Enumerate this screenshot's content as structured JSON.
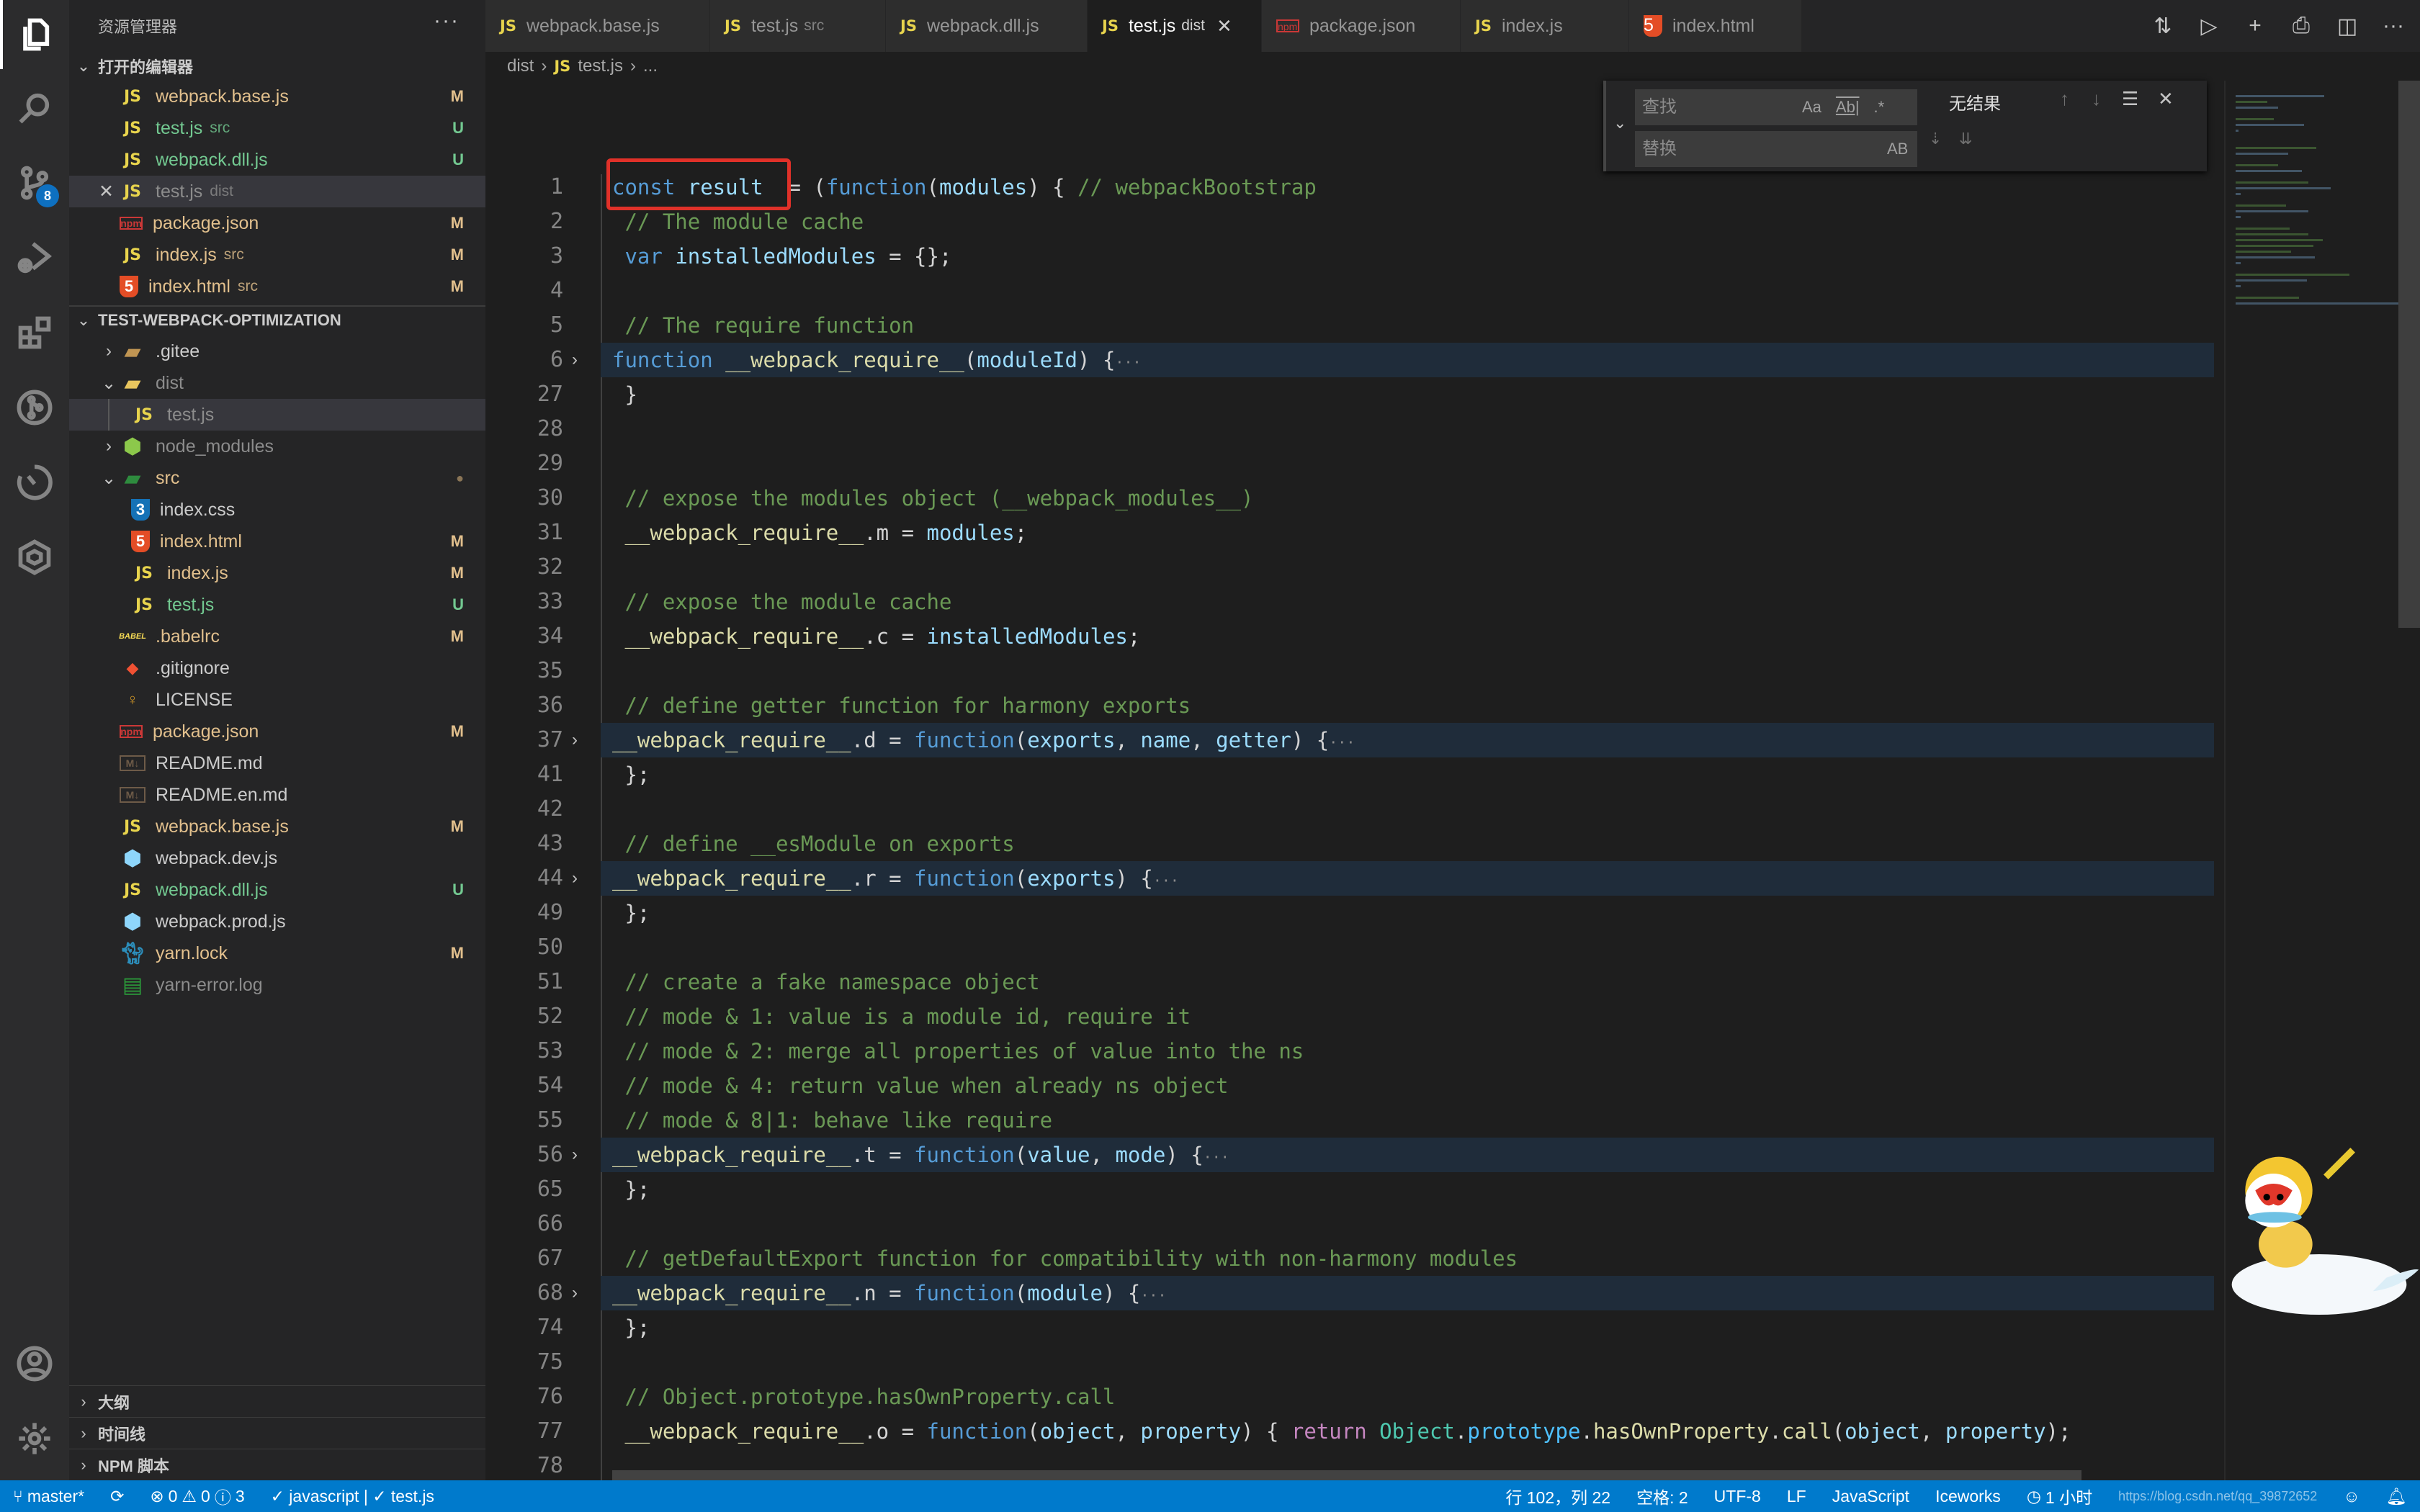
{
  "activity_bar": {
    "items": [
      {
        "name": "explorer",
        "icon": "files-icon",
        "active": true
      },
      {
        "name": "search",
        "icon": "search-icon"
      },
      {
        "name": "source-control",
        "icon": "source-control-icon",
        "badge": "8"
      },
      {
        "name": "run-debug",
        "icon": "debug-icon"
      },
      {
        "name": "extensions",
        "icon": "extensions-icon"
      },
      {
        "name": "git-graph",
        "icon": "git-graph-icon"
      },
      {
        "name": "timer",
        "icon": "timer-icon"
      },
      {
        "name": "iceworks",
        "icon": "iceworks-icon"
      }
    ],
    "bottom": [
      {
        "name": "accounts",
        "icon": "account-icon"
      },
      {
        "name": "manage",
        "icon": "gear-icon"
      }
    ]
  },
  "sidebar": {
    "title": "资源管理器",
    "more": "···",
    "open_editors": {
      "header": "打开的编辑器",
      "items": [
        {
          "icon": "JS",
          "name": "webpack.base.js",
          "sub": "",
          "status": "M",
          "kind": "mod"
        },
        {
          "icon": "JS",
          "name": "test.js",
          "sub": "src",
          "status": "U",
          "kind": "unt"
        },
        {
          "icon": "JS",
          "name": "webpack.dll.js",
          "sub": "",
          "status": "U",
          "kind": "unt"
        },
        {
          "icon": "JS",
          "name": "test.js",
          "sub": "dist",
          "status": "",
          "kind": "dim",
          "selected": true,
          "close": "✕"
        },
        {
          "icon": "npm",
          "name": "package.json",
          "sub": "",
          "status": "M",
          "kind": "mod"
        },
        {
          "icon": "JS",
          "name": "index.js",
          "sub": "src",
          "status": "M",
          "kind": "mod"
        },
        {
          "icon": "html",
          "name": "index.html",
          "sub": "src",
          "status": "M",
          "kind": "mod"
        }
      ]
    },
    "project": {
      "header": "TEST-WEBPACK-OPTIMIZATION",
      "items": [
        {
          "depth": 1,
          "twisty": "›",
          "icon": "folder",
          "name": ".gitee",
          "status": "",
          "kind": ""
        },
        {
          "depth": 1,
          "twisty": "⌄",
          "icon": "folder-open",
          "name": "dist",
          "status": "",
          "kind": "dim"
        },
        {
          "depth": 2,
          "twisty": "",
          "icon": "JS",
          "name": "test.js",
          "status": "",
          "kind": "dim",
          "selected": true
        },
        {
          "depth": 1,
          "twisty": "›",
          "icon": "node",
          "name": "node_modules",
          "status": "",
          "kind": "dim"
        },
        {
          "depth": 1,
          "twisty": "⌄",
          "icon": "src-folder",
          "name": "src",
          "status": "●",
          "kind": "mod"
        },
        {
          "depth": 2,
          "twisty": "",
          "icon": "css",
          "name": "index.css",
          "status": "",
          "kind": ""
        },
        {
          "depth": 2,
          "twisty": "",
          "icon": "html",
          "name": "index.html",
          "status": "M",
          "kind": "mod"
        },
        {
          "depth": 2,
          "twisty": "",
          "icon": "JS",
          "name": "index.js",
          "status": "M",
          "kind": "mod"
        },
        {
          "depth": 2,
          "twisty": "",
          "icon": "JS",
          "name": "test.js",
          "status": "U",
          "kind": "unt"
        },
        {
          "depth": 1,
          "twisty": "",
          "icon": "babel",
          "name": ".babelrc",
          "status": "M",
          "kind": "mod"
        },
        {
          "depth": 1,
          "twisty": "",
          "icon": "git",
          "name": ".gitignore",
          "status": "",
          "kind": ""
        },
        {
          "depth": 1,
          "twisty": "",
          "icon": "license",
          "name": "LICENSE",
          "status": "",
          "kind": ""
        },
        {
          "depth": 1,
          "twisty": "",
          "icon": "npm",
          "name": "package.json",
          "status": "M",
          "kind": "mod"
        },
        {
          "depth": 1,
          "twisty": "",
          "icon": "md",
          "name": "README.md",
          "status": "",
          "kind": ""
        },
        {
          "depth": 1,
          "twisty": "",
          "icon": "md",
          "name": "README.en.md",
          "status": "",
          "kind": ""
        },
        {
          "depth": 1,
          "twisty": "",
          "icon": "JS",
          "name": "webpack.base.js",
          "status": "M",
          "kind": "mod"
        },
        {
          "depth": 1,
          "twisty": "",
          "icon": "webpack",
          "name": "webpack.dev.js",
          "status": "",
          "kind": ""
        },
        {
          "depth": 1,
          "twisty": "",
          "icon": "JS",
          "name": "webpack.dll.js",
          "status": "U",
          "kind": "unt"
        },
        {
          "depth": 1,
          "twisty": "",
          "icon": "webpack",
          "name": "webpack.prod.js",
          "status": "",
          "kind": ""
        },
        {
          "depth": 1,
          "twisty": "",
          "icon": "yarn",
          "name": "yarn.lock",
          "status": "M",
          "kind": "mod"
        },
        {
          "depth": 1,
          "twisty": "",
          "icon": "log",
          "name": "yarn-error.log",
          "status": "",
          "kind": "dim"
        }
      ]
    },
    "bottom_sections": [
      "大纲",
      "时间线",
      "NPM 脚本"
    ]
  },
  "tabs": [
    {
      "icon": "JS",
      "name": "webpack.base.js",
      "sub": ""
    },
    {
      "icon": "JS",
      "name": "test.js",
      "sub": "src"
    },
    {
      "icon": "JS",
      "name": "webpack.dll.js",
      "sub": ""
    },
    {
      "icon": "JS",
      "name": "test.js",
      "sub": "dist",
      "active": true,
      "close": "✕"
    },
    {
      "icon": "npm",
      "name": "package.json",
      "sub": ""
    },
    {
      "icon": "JS",
      "name": "index.js",
      "sub": ""
    },
    {
      "icon": "html",
      "name": "index.html",
      "sub": ""
    }
  ],
  "tab_actions": [
    {
      "name": "open-changes",
      "glyph": "⇅"
    },
    {
      "name": "run",
      "glyph": "▷"
    },
    {
      "name": "new",
      "glyph": "+"
    },
    {
      "name": "preview",
      "glyph": "⎙"
    },
    {
      "name": "split-editor",
      "glyph": "◫"
    },
    {
      "name": "more-actions",
      "glyph": "···"
    }
  ],
  "breadcrumb": {
    "parts": [
      "dist",
      "test.js",
      "..."
    ],
    "sep": "›"
  },
  "find_widget": {
    "find_placeholder": "查找",
    "replace_placeholder": "替换",
    "match_case": "Aa",
    "whole_word": "Ab|",
    "regex": ".*",
    "preserve_case": "AB",
    "result": "无结果",
    "prev": "↑",
    "next": "↓",
    "in_selection": "☰",
    "close": "✕",
    "replace_one": "⇣",
    "replace_all": "⇊",
    "toggle": "⌄"
  },
  "editor": {
    "lines": [
      {
        "n": "1",
        "tokens": [
          [
            "kw",
            "const "
          ],
          [
            "var",
            "result"
          ],
          [
            "",
            "  = ("
          ],
          [
            "kw",
            "function"
          ],
          [
            "",
            "("
          ],
          [
            "var",
            "modules"
          ],
          [
            "",
            ") { "
          ],
          [
            "com",
            "// webpackBootstrap"
          ]
        ]
      },
      {
        "n": "2",
        "tokens": [
          [
            "com",
            " // The module cache"
          ]
        ]
      },
      {
        "n": "3",
        "tokens": [
          [
            "kw",
            " var "
          ],
          [
            "var",
            "installedModules"
          ],
          [
            "",
            " = {};"
          ]
        ]
      },
      {
        "n": "4",
        "tokens": []
      },
      {
        "n": "5",
        "tokens": [
          [
            "com",
            " // The require function"
          ]
        ]
      },
      {
        "n": "6",
        "fold": true,
        "tokens": [
          [
            "kw",
            "function "
          ],
          [
            "fn",
            "__webpack_require__"
          ],
          [
            "",
            "("
          ],
          [
            "var",
            "moduleId"
          ],
          [
            "",
            ") {"
          ],
          [
            "ell",
            "···"
          ]
        ]
      },
      {
        "n": "27",
        "tokens": [
          [
            "",
            " }"
          ]
        ]
      },
      {
        "n": "28",
        "tokens": []
      },
      {
        "n": "29",
        "tokens": []
      },
      {
        "n": "30",
        "tokens": [
          [
            "com",
            " // expose the modules object (__webpack_modules__)"
          ]
        ]
      },
      {
        "n": "31",
        "tokens": [
          [
            "fn",
            " __webpack_require__"
          ],
          [
            "",
            ".m = "
          ],
          [
            "var",
            "modules"
          ],
          [
            "",
            ";"
          ]
        ]
      },
      {
        "n": "32",
        "tokens": []
      },
      {
        "n": "33",
        "tokens": [
          [
            "com",
            " // expose the module cache"
          ]
        ]
      },
      {
        "n": "34",
        "tokens": [
          [
            "fn",
            " __webpack_require__"
          ],
          [
            "",
            ".c = "
          ],
          [
            "var",
            "installedModules"
          ],
          [
            "",
            ";"
          ]
        ]
      },
      {
        "n": "35",
        "tokens": []
      },
      {
        "n": "36",
        "tokens": [
          [
            "com",
            " // define getter function for harmony exports"
          ]
        ]
      },
      {
        "n": "37",
        "fold": true,
        "tokens": [
          [
            "fn",
            "__webpack_require__"
          ],
          [
            "",
            ".d = "
          ],
          [
            "kw",
            "function"
          ],
          [
            "",
            "("
          ],
          [
            "var",
            "exports"
          ],
          [
            "",
            ", "
          ],
          [
            "var",
            "name"
          ],
          [
            "",
            ", "
          ],
          [
            "var",
            "getter"
          ],
          [
            "",
            ") {"
          ],
          [
            "ell",
            "···"
          ]
        ]
      },
      {
        "n": "41",
        "tokens": [
          [
            "",
            " };"
          ]
        ]
      },
      {
        "n": "42",
        "tokens": []
      },
      {
        "n": "43",
        "tokens": [
          [
            "com",
            " // define __esModule on exports"
          ]
        ]
      },
      {
        "n": "44",
        "fold": true,
        "tokens": [
          [
            "fn",
            "__webpack_require__"
          ],
          [
            "",
            ".r = "
          ],
          [
            "kw",
            "function"
          ],
          [
            "",
            "("
          ],
          [
            "var",
            "exports"
          ],
          [
            "",
            ") {"
          ],
          [
            "ell",
            "···"
          ]
        ]
      },
      {
        "n": "49",
        "tokens": [
          [
            "",
            " };"
          ]
        ]
      },
      {
        "n": "50",
        "tokens": []
      },
      {
        "n": "51",
        "tokens": [
          [
            "com",
            " // create a fake namespace object"
          ]
        ]
      },
      {
        "n": "52",
        "tokens": [
          [
            "com",
            " // mode & 1: value is a module id, require it"
          ]
        ]
      },
      {
        "n": "53",
        "tokens": [
          [
            "com",
            " // mode & 2: merge all properties of value into the ns"
          ]
        ]
      },
      {
        "n": "54",
        "tokens": [
          [
            "com",
            " // mode & 4: return value when already ns object"
          ]
        ]
      },
      {
        "n": "55",
        "tokens": [
          [
            "com",
            " // mode & 8|1: behave like require"
          ]
        ]
      },
      {
        "n": "56",
        "fold": true,
        "tokens": [
          [
            "fn",
            "__webpack_require__"
          ],
          [
            "",
            ".t = "
          ],
          [
            "kw",
            "function"
          ],
          [
            "",
            "("
          ],
          [
            "var",
            "value"
          ],
          [
            "",
            ", "
          ],
          [
            "var",
            "mode"
          ],
          [
            "",
            ") {"
          ],
          [
            "ell",
            "···"
          ]
        ]
      },
      {
        "n": "65",
        "tokens": [
          [
            "",
            " };"
          ]
        ]
      },
      {
        "n": "66",
        "tokens": []
      },
      {
        "n": "67",
        "tokens": [
          [
            "com",
            " // getDefaultExport function for compatibility with non-harmony modules"
          ]
        ]
      },
      {
        "n": "68",
        "fold": true,
        "tokens": [
          [
            "fn",
            "__webpack_require__"
          ],
          [
            "",
            ".n = "
          ],
          [
            "kw",
            "function"
          ],
          [
            "",
            "("
          ],
          [
            "var",
            "module"
          ],
          [
            "",
            ") {"
          ],
          [
            "ell",
            "···"
          ]
        ]
      },
      {
        "n": "74",
        "tokens": [
          [
            "",
            " };"
          ]
        ]
      },
      {
        "n": "75",
        "tokens": []
      },
      {
        "n": "76",
        "tokens": [
          [
            "com",
            " // Object.prototype.hasOwnProperty.call"
          ]
        ]
      },
      {
        "n": "77",
        "tokens": [
          [
            "fn",
            " __webpack_require__"
          ],
          [
            "",
            ".o = "
          ],
          [
            "kw",
            "function"
          ],
          [
            "",
            "("
          ],
          [
            "var",
            "object"
          ],
          [
            "",
            ", "
          ],
          [
            "var",
            "property"
          ],
          [
            "",
            ") { "
          ],
          [
            "ret",
            "return "
          ],
          [
            "cls",
            "Object"
          ],
          [
            "",
            "."
          ],
          [
            "prop",
            "prototype"
          ],
          [
            "",
            "."
          ],
          [
            "fn",
            "hasOwnProperty"
          ],
          [
            "",
            "."
          ],
          [
            "fn",
            "call"
          ],
          [
            "",
            "("
          ],
          [
            "var",
            "object"
          ],
          [
            "",
            ", "
          ],
          [
            "var",
            "property"
          ],
          [
            "",
            ");"
          ]
        ]
      },
      {
        "n": "78",
        "tokens": []
      }
    ]
  },
  "status_bar": {
    "branch": "master*",
    "sync": "⟳",
    "errors": "0",
    "warnings": "0",
    "infos": "3",
    "lint": "✓ javascript | ✓ test.js",
    "position": "行 102，列 22",
    "spaces": "空格: 2",
    "encoding": "UTF-8",
    "eol": "LF",
    "language": "JavaScript",
    "iceworks": "Iceworks",
    "timer": "1 小时",
    "watermark": "https://blog.csdn.net/qq_39872652"
  }
}
